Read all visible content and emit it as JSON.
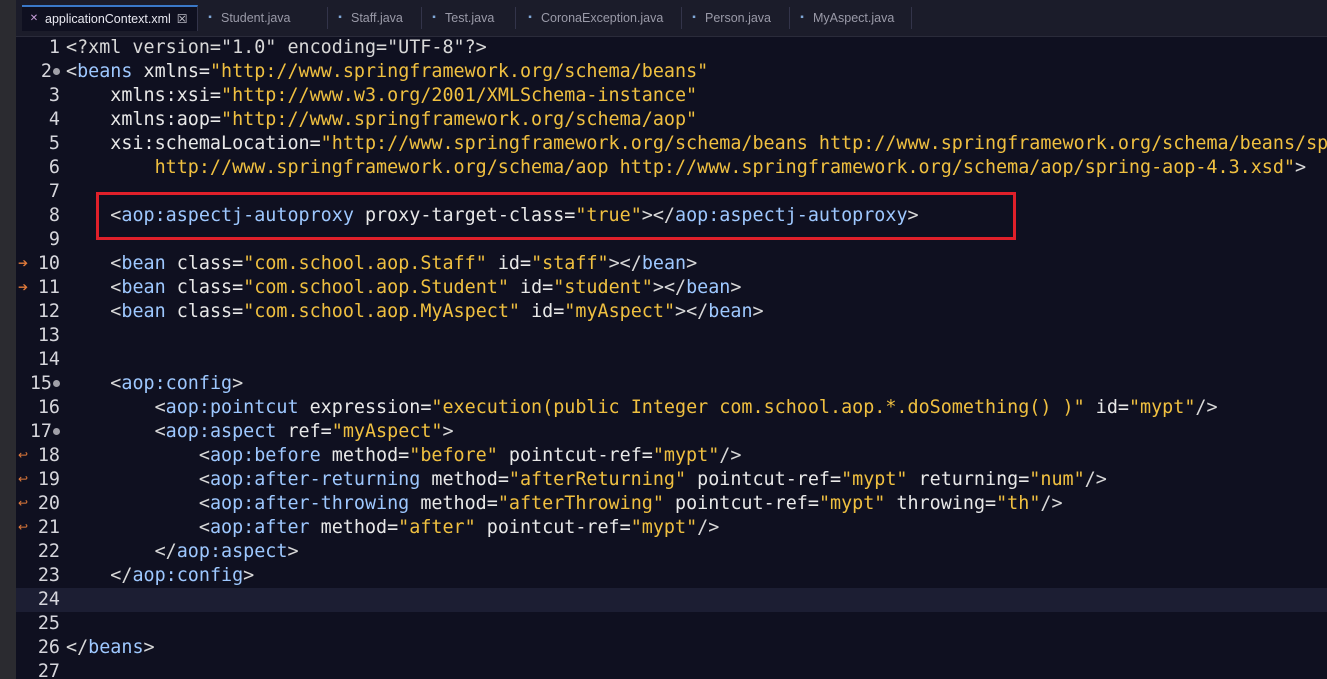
{
  "tabs": [
    {
      "label": "applicationContext.xml",
      "icon": "xml-file-icon",
      "active": true,
      "closable": true
    },
    {
      "label": "Student.java",
      "icon": "java-file-icon"
    },
    {
      "label": "Staff.java",
      "icon": "java-file-icon"
    },
    {
      "label": "Test.java",
      "icon": "java-file-icon"
    },
    {
      "label": "CoronaException.java",
      "icon": "java-file-icon"
    },
    {
      "label": "Person.java",
      "icon": "java-file-icon"
    },
    {
      "label": "MyAspect.java",
      "icon": "java-file-icon"
    }
  ],
  "current_line": 24,
  "highlight_line": 8,
  "highlight_color": "#e0202a",
  "colors": {
    "background": "#0f1020",
    "tag": "#9ec8ff",
    "attr": "#e8e8e8",
    "value": "#f0c040"
  },
  "lines": [
    {
      "n": "1",
      "fold": false,
      "ann": "",
      "tokens": [
        [
          "p",
          "<?xml version=\"1.0\" encoding=\"UTF-8\"?>"
        ]
      ]
    },
    {
      "n": "2",
      "fold": true,
      "ann": "",
      "tokens": [
        [
          "p",
          "<"
        ],
        [
          "t",
          "beans"
        ],
        [
          "a",
          " xmlns="
        ],
        [
          "v",
          "\"http://www.springframework.org/schema/beans\""
        ]
      ]
    },
    {
      "n": "3",
      "fold": false,
      "ann": "",
      "tokens": [
        [
          "a",
          "    xmlns:xsi="
        ],
        [
          "v",
          "\"http://www.w3.org/2001/XMLSchema-instance\""
        ]
      ]
    },
    {
      "n": "4",
      "fold": false,
      "ann": "",
      "tokens": [
        [
          "a",
          "    xmlns:aop="
        ],
        [
          "v",
          "\"http://www.springframework.org/schema/aop\""
        ]
      ]
    },
    {
      "n": "5",
      "fold": false,
      "ann": "",
      "tokens": [
        [
          "a",
          "    xsi:schemaLocation="
        ],
        [
          "v",
          "\"http://www.springframework.org/schema/beans http://www.springframework.org/schema/beans/spring-beans.xsd"
        ]
      ]
    },
    {
      "n": "6",
      "fold": false,
      "ann": "",
      "tokens": [
        [
          "v",
          "        http://www.springframework.org/schema/aop http://www.springframework.org/schema/aop/spring-aop-4.3.xsd\""
        ],
        [
          "p",
          ">"
        ]
      ]
    },
    {
      "n": "7",
      "fold": false,
      "ann": "",
      "tokens": []
    },
    {
      "n": "8",
      "fold": false,
      "ann": "",
      "tokens": [
        [
          "p",
          "    <"
        ],
        [
          "t",
          "aop:aspectj-autoproxy"
        ],
        [
          "a",
          " proxy-target-class="
        ],
        [
          "v",
          "\"true\""
        ],
        [
          "p",
          "></"
        ],
        [
          "t",
          "aop:aspectj-autoproxy"
        ],
        [
          "p",
          ">"
        ]
      ]
    },
    {
      "n": "9",
      "fold": false,
      "ann": "",
      "tokens": []
    },
    {
      "n": "10",
      "fold": false,
      "ann": "arrow",
      "tokens": [
        [
          "p",
          "    <"
        ],
        [
          "t",
          "bean"
        ],
        [
          "a",
          " class="
        ],
        [
          "v",
          "\"com.school.aop.Staff\""
        ],
        [
          "a",
          " id="
        ],
        [
          "v",
          "\"staff\""
        ],
        [
          "p",
          "></"
        ],
        [
          "t",
          "bean"
        ],
        [
          "p",
          ">"
        ]
      ]
    },
    {
      "n": "11",
      "fold": false,
      "ann": "arrow",
      "tokens": [
        [
          "p",
          "    <"
        ],
        [
          "t",
          "bean"
        ],
        [
          "a",
          " class="
        ],
        [
          "v",
          "\"com.school.aop.Student\""
        ],
        [
          "a",
          " id="
        ],
        [
          "v",
          "\"student\""
        ],
        [
          "p",
          "></"
        ],
        [
          "t",
          "bean"
        ],
        [
          "p",
          ">"
        ]
      ]
    },
    {
      "n": "12",
      "fold": false,
      "ann": "",
      "tokens": [
        [
          "p",
          "    <"
        ],
        [
          "t",
          "bean"
        ],
        [
          "a",
          " class="
        ],
        [
          "v",
          "\"com.school.aop.MyAspect\""
        ],
        [
          "a",
          " id="
        ],
        [
          "v",
          "\"myAspect\""
        ],
        [
          "p",
          "></"
        ],
        [
          "t",
          "bean"
        ],
        [
          "p",
          ">"
        ]
      ]
    },
    {
      "n": "13",
      "fold": false,
      "ann": "",
      "tokens": []
    },
    {
      "n": "14",
      "fold": false,
      "ann": "",
      "tokens": []
    },
    {
      "n": "15",
      "fold": true,
      "ann": "",
      "tokens": [
        [
          "p",
          "    <"
        ],
        [
          "t",
          "aop:config"
        ],
        [
          "p",
          ">"
        ]
      ]
    },
    {
      "n": "16",
      "fold": false,
      "ann": "",
      "tokens": [
        [
          "p",
          "        <"
        ],
        [
          "t",
          "aop:pointcut"
        ],
        [
          "a",
          " expression="
        ],
        [
          "v",
          "\"execution(public Integer com.school.aop.*.doSomething() )\""
        ],
        [
          "a",
          " id="
        ],
        [
          "v",
          "\"mypt\""
        ],
        [
          "p",
          "/>"
        ]
      ]
    },
    {
      "n": "17",
      "fold": true,
      "ann": "",
      "tokens": [
        [
          "p",
          "        <"
        ],
        [
          "t",
          "aop:aspect"
        ],
        [
          "a",
          " ref="
        ],
        [
          "v",
          "\"myAspect\""
        ],
        [
          "p",
          ">"
        ]
      ]
    },
    {
      "n": "18",
      "fold": false,
      "ann": "back",
      "tokens": [
        [
          "p",
          "            <"
        ],
        [
          "t",
          "aop:before"
        ],
        [
          "a",
          " method="
        ],
        [
          "v",
          "\"before\""
        ],
        [
          "a",
          " pointcut-ref="
        ],
        [
          "v",
          "\"mypt\""
        ],
        [
          "p",
          "/>"
        ]
      ]
    },
    {
      "n": "19",
      "fold": false,
      "ann": "back",
      "tokens": [
        [
          "p",
          "            <"
        ],
        [
          "t",
          "aop:after-returning"
        ],
        [
          "a",
          " method="
        ],
        [
          "v",
          "\"afterReturning\""
        ],
        [
          "a",
          " pointcut-ref="
        ],
        [
          "v",
          "\"mypt\""
        ],
        [
          "a",
          " returning="
        ],
        [
          "v",
          "\"num\""
        ],
        [
          "p",
          "/>"
        ]
      ]
    },
    {
      "n": "20",
      "fold": false,
      "ann": "back",
      "tokens": [
        [
          "p",
          "            <"
        ],
        [
          "t",
          "aop:after-throwing"
        ],
        [
          "a",
          " method="
        ],
        [
          "v",
          "\"afterThrowing\""
        ],
        [
          "a",
          " pointcut-ref="
        ],
        [
          "v",
          "\"mypt\""
        ],
        [
          "a",
          " throwing="
        ],
        [
          "v",
          "\"th\""
        ],
        [
          "p",
          "/>"
        ]
      ]
    },
    {
      "n": "21",
      "fold": false,
      "ann": "back",
      "tokens": [
        [
          "p",
          "            <"
        ],
        [
          "t",
          "aop:after"
        ],
        [
          "a",
          " method="
        ],
        [
          "v",
          "\"after\""
        ],
        [
          "a",
          " pointcut-ref="
        ],
        [
          "v",
          "\"mypt\""
        ],
        [
          "p",
          "/>"
        ]
      ]
    },
    {
      "n": "22",
      "fold": false,
      "ann": "",
      "tokens": [
        [
          "p",
          "        </"
        ],
        [
          "t",
          "aop:aspect"
        ],
        [
          "p",
          ">"
        ]
      ]
    },
    {
      "n": "23",
      "fold": false,
      "ann": "",
      "tokens": [
        [
          "p",
          "    </"
        ],
        [
          "t",
          "aop:config"
        ],
        [
          "p",
          ">"
        ]
      ]
    },
    {
      "n": "24",
      "fold": false,
      "ann": "",
      "tokens": []
    },
    {
      "n": "25",
      "fold": false,
      "ann": "",
      "tokens": []
    },
    {
      "n": "26",
      "fold": false,
      "ann": "",
      "tokens": [
        [
          "p",
          "</"
        ],
        [
          "t",
          "beans"
        ],
        [
          "p",
          ">"
        ]
      ]
    },
    {
      "n": "27",
      "fold": false,
      "ann": "",
      "tokens": []
    }
  ]
}
